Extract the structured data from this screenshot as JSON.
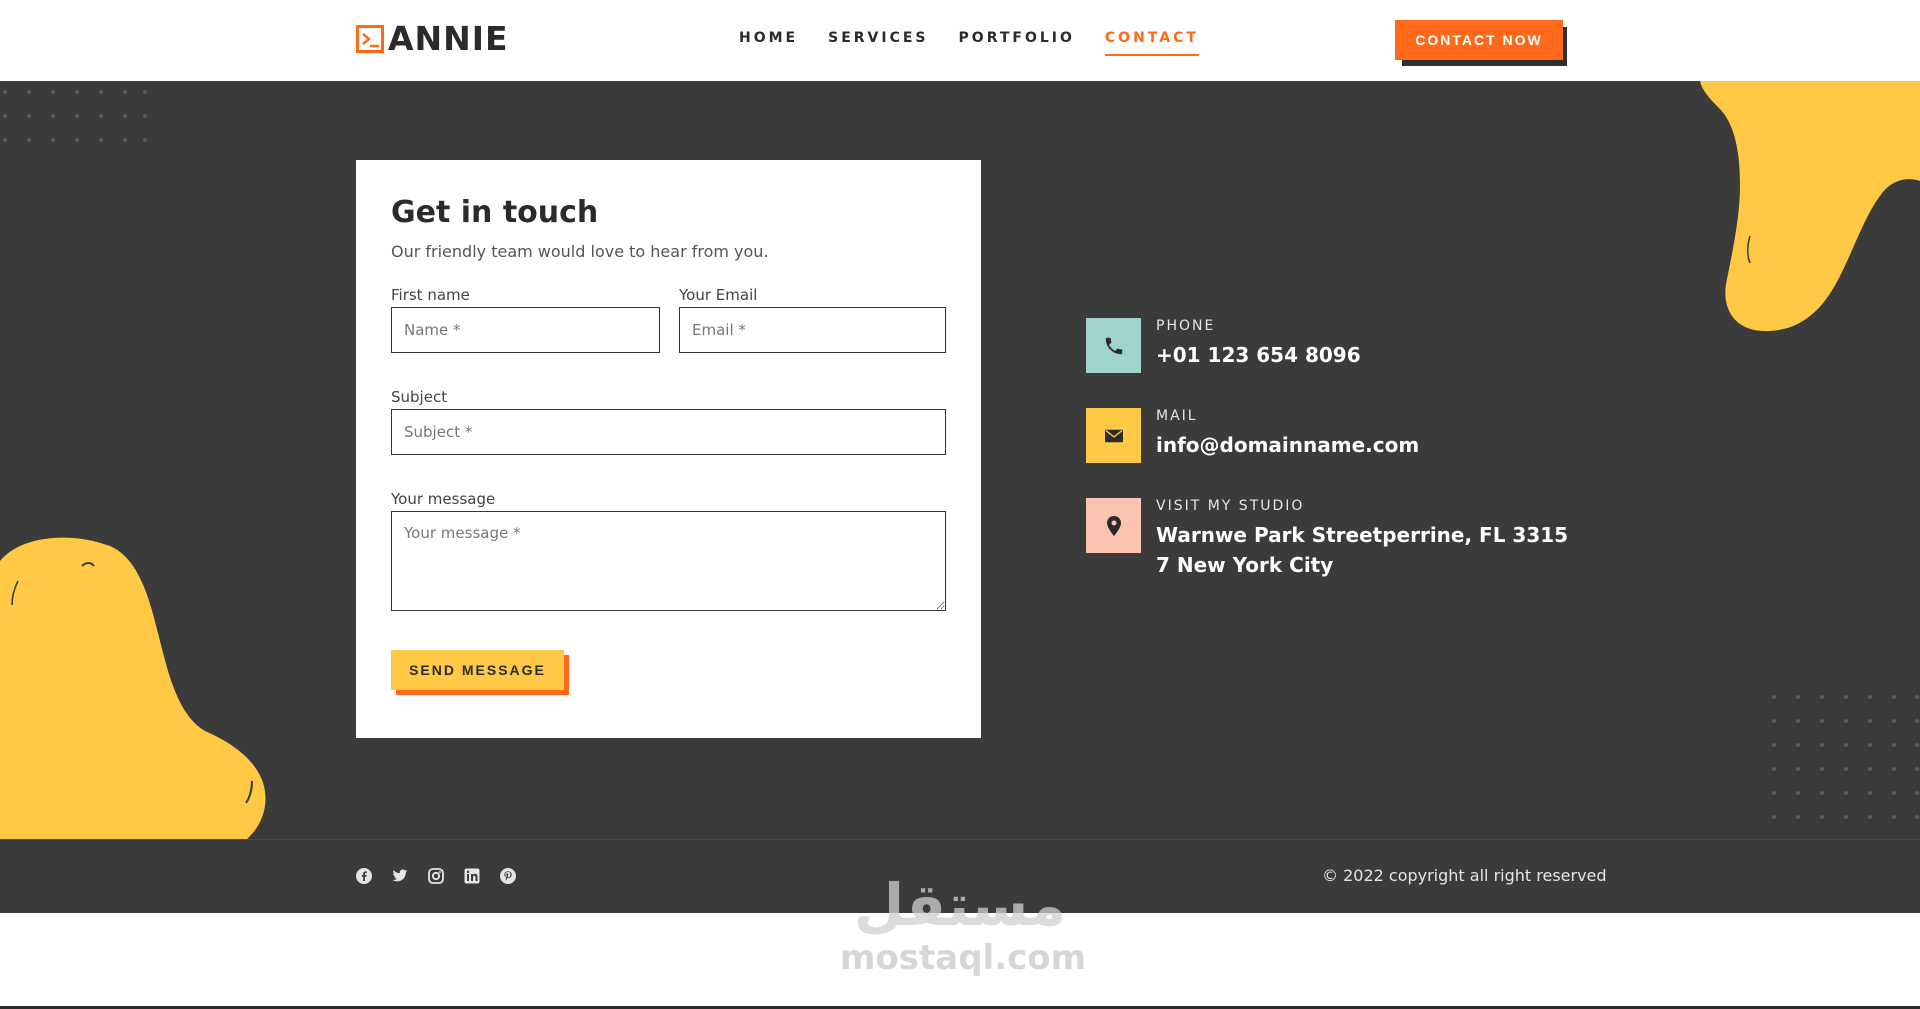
{
  "brand": {
    "name": "ANNIE",
    "accent": "#ff6a1a",
    "dark": "#3b3b3b",
    "yellow": "#ffc845"
  },
  "nav": {
    "items": [
      {
        "label": "HOME",
        "active": false
      },
      {
        "label": "SERVICES",
        "active": false
      },
      {
        "label": "PORTFOLIO",
        "active": false
      },
      {
        "label": "CONTACT",
        "active": true
      }
    ],
    "cta_label": "CONTACT NOW"
  },
  "form": {
    "title": "Get in touch",
    "subtitle": "Our friendly team would love to hear from you.",
    "first_name": {
      "label": "First name",
      "placeholder": "Name *"
    },
    "email": {
      "label": "Your Email",
      "placeholder": "Email *"
    },
    "subject": {
      "label": "Subject",
      "placeholder": "Subject *"
    },
    "message": {
      "label": "Your message",
      "placeholder": "Your message *"
    },
    "submit_label": "SEND MESSAGE"
  },
  "contact": {
    "phone": {
      "label": "PHONE",
      "value": "+01 123 654 8096",
      "icon": "phone-icon",
      "color": "#9fd3d0"
    },
    "mail": {
      "label": "MAIL",
      "value": "info@domainname.com",
      "icon": "mail-icon",
      "color": "#ffc845"
    },
    "studio": {
      "label": "VISIT MY STUDIO",
      "line1": "Warnwe Park Streetperrine, FL 3315",
      "line2": "7 New York City",
      "icon": "location-pin-icon",
      "color": "#fbc4ae"
    }
  },
  "footer": {
    "socials": [
      "facebook-icon",
      "twitter-icon",
      "instagram-icon",
      "linkedin-icon",
      "pinterest-icon"
    ],
    "copyright": "© 2022 copyright all right reserved"
  },
  "watermark": {
    "arabic": "مستقل",
    "latin": "mostaql.com"
  }
}
